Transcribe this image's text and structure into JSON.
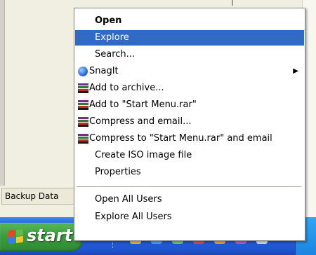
{
  "background": {
    "status_text": "Backup Data"
  },
  "taskbar": {
    "start_label": "start"
  },
  "context_menu": {
    "items": [
      {
        "label": "Open",
        "bold": true
      },
      {
        "label": "Explore",
        "highlighted": true
      },
      {
        "label": "Search..."
      },
      {
        "label": "SnagIt",
        "icon": "snagit-icon",
        "submenu": true
      },
      {
        "label": "Add to archive...",
        "icon": "winrar-icon"
      },
      {
        "label": "Add to \"Start Menu.rar\"",
        "icon": "winrar-icon"
      },
      {
        "label": "Compress and email...",
        "icon": "winrar-icon"
      },
      {
        "label": "Compress to \"Start Menu.rar\" and email",
        "icon": "winrar-icon"
      },
      {
        "label": "Create ISO image file"
      },
      {
        "label": "Properties"
      },
      {
        "label": "Open All Users"
      },
      {
        "label": "Explore All Users"
      }
    ],
    "submenu_arrow": "▶"
  },
  "colors": {
    "highlight": "#316ac5",
    "taskbar": "#245edb",
    "start_button": "#3c9e3e"
  }
}
